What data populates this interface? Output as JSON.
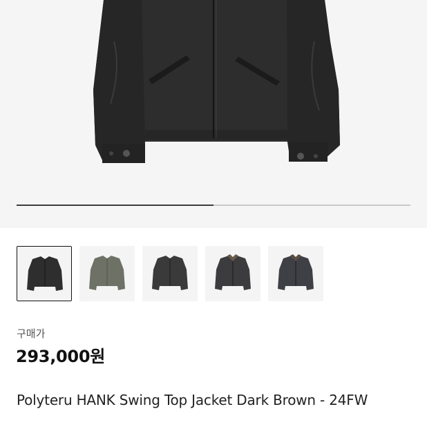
{
  "gallery": {
    "progress": 0.5,
    "thumbnails": [
      {
        "color": "#2e2e2e",
        "selected": true
      },
      {
        "color": "#6e7166",
        "selected": false
      },
      {
        "color": "#3a3a3a",
        "selected": false
      },
      {
        "color": "#3c3c3e",
        "selected": false
      },
      {
        "color": "#3f4045",
        "selected": false
      }
    ]
  },
  "product": {
    "price_label": "구매가",
    "price": "293,000원",
    "title": "Polyteru HANK Swing Top Jacket Dark Brown - 24FW"
  }
}
